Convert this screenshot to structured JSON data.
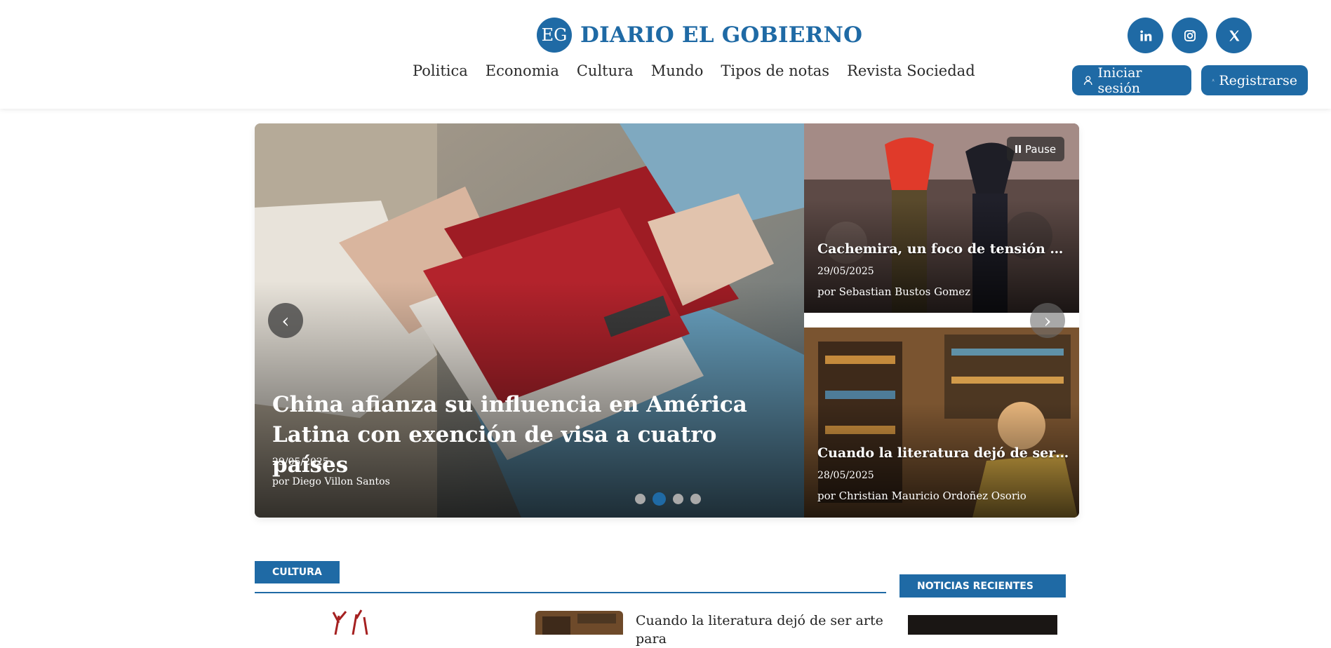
{
  "brand": {
    "logo_text": "EG",
    "name": "DIARIO EL GOBIERNO"
  },
  "nav": [
    "Politica",
    "Economia",
    "Cultura",
    "Mundo",
    "Tipos de notas",
    "Revista Sociedad"
  ],
  "socials": [
    "linkedin-icon",
    "instagram-icon",
    "x-icon"
  ],
  "auth": {
    "login": "Iniciar sesión",
    "register": "Registrarse"
  },
  "slider": {
    "main": {
      "title": "China afianza su influencia en América Latina con exención de visa a cuatro países",
      "date": "29/05/2025",
      "author": "por Diego Villon Santos"
    },
    "side": [
      {
        "title": "Cachemira, un foco de tensión nuclear",
        "date": "29/05/2025",
        "author": "por Sebastian Bustos Gomez"
      },
      {
        "title": "Cuando la literatura dejó de ser arte para…",
        "date": "28/05/2025",
        "author": "por Christian Mauricio Ordoñez Osorio"
      }
    ],
    "pause_label": "Pause",
    "prev_symbol": "‹",
    "next_symbol": "›",
    "dots_count": 4,
    "active_dot": 1
  },
  "section": {
    "tag": "CULTURA",
    "first_title": "Cuando la literatura dejó de ser arte para"
  },
  "sidebar": {
    "tag": "NOTICIAS RECIENTES"
  },
  "colors": {
    "accent": "#1f6aa5"
  }
}
